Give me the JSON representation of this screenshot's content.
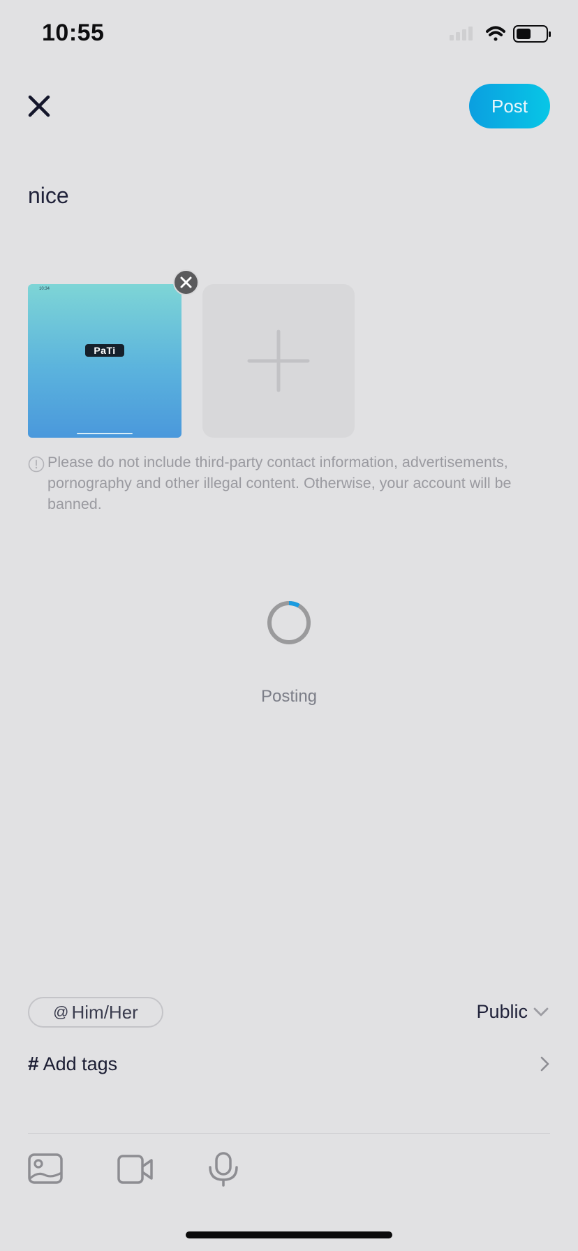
{
  "status_bar": {
    "time": "10:55"
  },
  "header": {
    "post_label": "Post"
  },
  "composer": {
    "text": "nice"
  },
  "media": {
    "thumb_brand": "PaTi",
    "thumb_time": "10:34"
  },
  "notice": {
    "text": "Please do not include third-party contact information, advertisements, pornography and other illegal content. Otherwise, your account will be banned."
  },
  "loading": {
    "label": "Posting"
  },
  "options": {
    "mention_symbol": "@",
    "mention_label": "Him/Her",
    "visibility_label": "Public",
    "tags_symbol": "#",
    "tags_label": "Add tags"
  },
  "toolbar": {
    "icons": [
      "image-icon",
      "video-icon",
      "microphone-icon"
    ]
  },
  "colors": {
    "background": "#e1e1e3",
    "accent": "#0aaee3",
    "spinner_track": "#9a9a9c",
    "spinner_arc": "#1a9be0"
  }
}
